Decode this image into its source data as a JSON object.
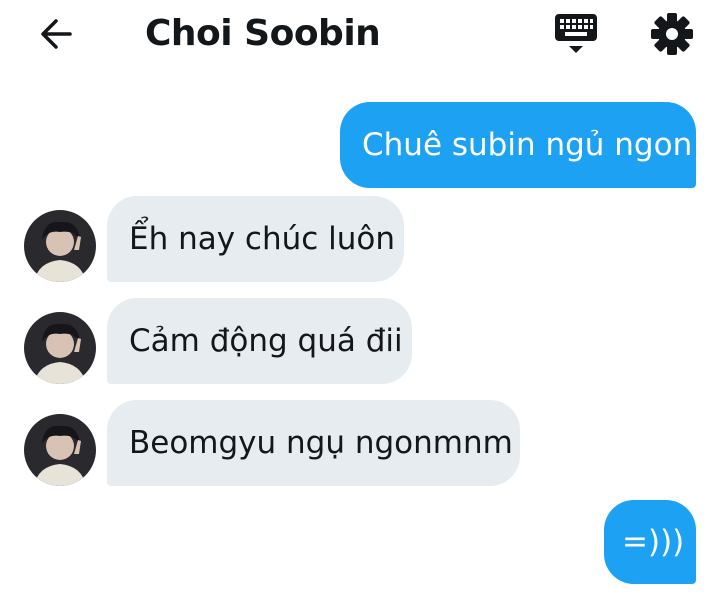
{
  "header": {
    "title": "Choi Soobin",
    "back_icon": "arrow-left-icon",
    "keyboard_icon": "keyboard-icon",
    "settings_icon": "gear-icon"
  },
  "messages": [
    {
      "direction": "outgoing",
      "text": "Chuê subin ngủ ngon"
    },
    {
      "direction": "incoming",
      "text": "Ểh nay chúc luôn"
    },
    {
      "direction": "incoming",
      "text": "Cảm động quá đii"
    },
    {
      "direction": "incoming",
      "text": "Beomgyu ngụ ngonmnm"
    },
    {
      "direction": "outgoing",
      "text": "=)))"
    }
  ],
  "colors": {
    "outgoing_bubble": "#1da1f2",
    "incoming_bubble": "#e6ecf0",
    "text_dark": "#14171a"
  }
}
